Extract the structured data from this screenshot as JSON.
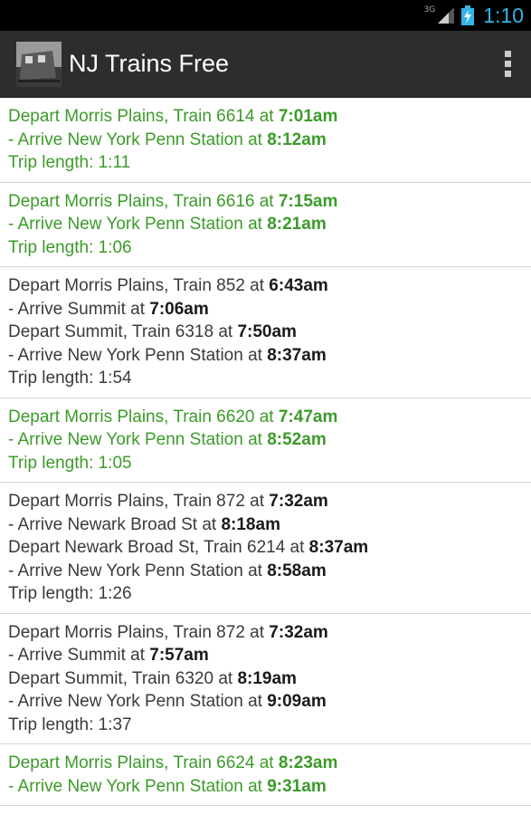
{
  "status_bar": {
    "network": "3G",
    "time": "1:10",
    "icons": [
      "signal-icon",
      "battery-icon"
    ]
  },
  "action_bar": {
    "title": "NJ Trains Free",
    "menu_icon": "overflow-menu-icon"
  },
  "colors": {
    "direct_trip": "#3c9a2a",
    "transfer_trip": "#3a3a3a",
    "time_accent": "#33b5e5"
  },
  "trips": [
    {
      "type": "direct",
      "legs": [
        {
          "depart_text": "Depart Morris Plains, Train 6614 at ",
          "depart_time": "7:01am",
          "arrive_text": "- Arrive New York Penn Station at ",
          "arrive_time": "8:12am"
        }
      ],
      "length": "Trip length: 1:11"
    },
    {
      "type": "direct",
      "legs": [
        {
          "depart_text": "Depart Morris Plains, Train 6616 at ",
          "depart_time": "7:15am",
          "arrive_text": "- Arrive New York Penn Station at ",
          "arrive_time": "8:21am"
        }
      ],
      "length": "Trip length: 1:06"
    },
    {
      "type": "transfer",
      "legs": [
        {
          "depart_text": "Depart Morris Plains, Train 852 at ",
          "depart_time": "6:43am",
          "arrive_text": "- Arrive Summit at ",
          "arrive_time": "7:06am"
        },
        {
          "depart_text": "Depart Summit, Train 6318 at ",
          "depart_time": "7:50am",
          "arrive_text": "- Arrive New York Penn Station at ",
          "arrive_time": "8:37am"
        }
      ],
      "length": "Trip length: 1:54"
    },
    {
      "type": "direct",
      "legs": [
        {
          "depart_text": "Depart Morris Plains, Train 6620 at ",
          "depart_time": "7:47am",
          "arrive_text": "- Arrive New York Penn Station at ",
          "arrive_time": "8:52am"
        }
      ],
      "length": "Trip length: 1:05"
    },
    {
      "type": "transfer",
      "legs": [
        {
          "depart_text": "Depart Morris Plains, Train 872 at ",
          "depart_time": "7:32am",
          "arrive_text": "- Arrive Newark Broad St at ",
          "arrive_time": "8:18am"
        },
        {
          "depart_text": "Depart Newark Broad St, Train 6214 at ",
          "depart_time": "8:37am",
          "arrive_text": "- Arrive New York Penn Station at ",
          "arrive_time": "8:58am"
        }
      ],
      "length": "Trip length: 1:26"
    },
    {
      "type": "transfer",
      "legs": [
        {
          "depart_text": "Depart Morris Plains, Train 872 at ",
          "depart_time": "7:32am",
          "arrive_text": "- Arrive Summit at ",
          "arrive_time": "7:57am"
        },
        {
          "depart_text": "Depart Summit, Train 6320 at ",
          "depart_time": "8:19am",
          "arrive_text": "- Arrive New York Penn Station at ",
          "arrive_time": "9:09am"
        }
      ],
      "length": "Trip length: 1:37"
    },
    {
      "type": "direct",
      "legs": [
        {
          "depart_text": "Depart Morris Plains, Train 6624 at ",
          "depart_time": "8:23am",
          "arrive_text": "- Arrive New York Penn Station at ",
          "arrive_time": "9:31am"
        }
      ],
      "length": ""
    }
  ]
}
